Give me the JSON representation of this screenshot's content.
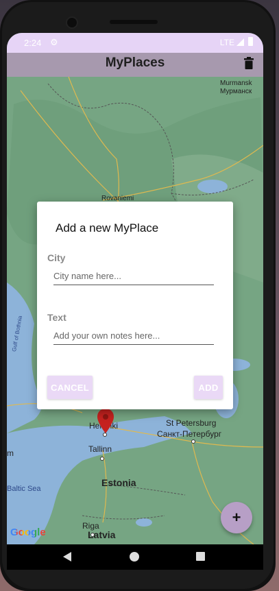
{
  "status_bar": {
    "time": "2:24",
    "network": "LTE"
  },
  "app_bar": {
    "title": "MyPlaces"
  },
  "map": {
    "labels": {
      "murmansk": "Murmansk",
      "murmansk_cyrillic": "Мурманск",
      "rovaniemi": "Rovaniemi",
      "gulf_of_bothnia": "Gulf of Bothnia",
      "helsinki": "Helsinki",
      "st_petersburg": "St Petersburg",
      "st_petersburg_cyrillic": "Санкт-Петербург",
      "tallinn": "Tallinn",
      "estonia": "Estonia",
      "baltic_sea": "Baltic Sea",
      "riga": "Riga",
      "latvia": "Latvia",
      "left_edge": "m"
    },
    "attribution": "Google"
  },
  "dialog": {
    "title": "Add a new MyPlace",
    "city_label": "City",
    "city_value": "",
    "city_placeholder": "City name here...",
    "text_label": "Text",
    "text_value": "",
    "text_placeholder": "Add your own notes here...",
    "cancel_label": "CANCEL",
    "add_label": "ADD"
  },
  "fab": {
    "label": "+"
  },
  "colors": {
    "status_bar": "#e6d4f6",
    "app_bar": "#a799ae",
    "button_bg": "#ead9f6",
    "fab": "#b79fc6",
    "marker": "#c5221f"
  },
  "icons": {
    "settings": "gear-icon",
    "delete": "trash-icon",
    "marker": "map-marker-icon",
    "back": "nav-back-icon",
    "home": "nav-home-icon",
    "recents": "nav-recents-icon"
  }
}
